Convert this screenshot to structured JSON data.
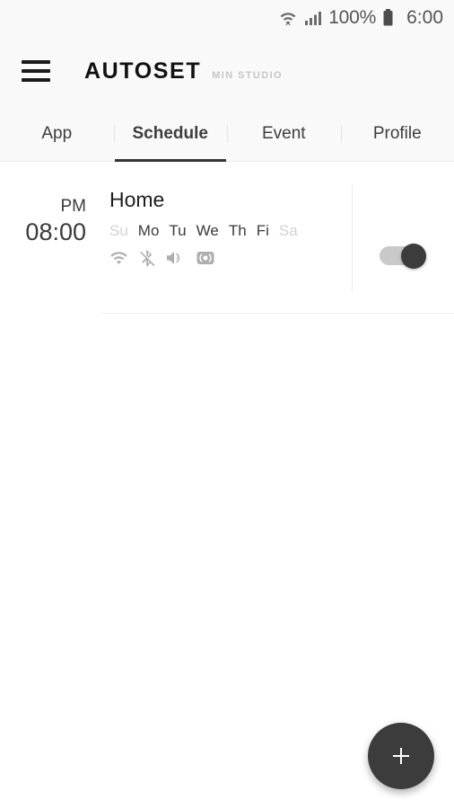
{
  "status_bar": {
    "battery_percent": "100%",
    "clock": "6:00",
    "icons": [
      "wifi-data-icon",
      "cellular-signal-icon",
      "battery-icon"
    ]
  },
  "app_bar": {
    "menu_icon": "hamburger-menu-icon",
    "brand": "AUTOSET",
    "brand_sub": "MIN STUDIO"
  },
  "tabs": [
    {
      "label": "App",
      "active": false
    },
    {
      "label": "Schedule",
      "active": true
    },
    {
      "label": "Event",
      "active": false
    },
    {
      "label": "Profile",
      "active": false
    }
  ],
  "schedules": [
    {
      "meridiem": "PM",
      "time": "08:00",
      "title": "Home",
      "days": [
        {
          "label": "Su",
          "active": false
        },
        {
          "label": "Mo",
          "active": true
        },
        {
          "label": "Tu",
          "active": true
        },
        {
          "label": "We",
          "active": true
        },
        {
          "label": "Th",
          "active": true
        },
        {
          "label": "Fi",
          "active": true
        },
        {
          "label": "Sa",
          "active": false
        }
      ],
      "flags": [
        "wifi-icon",
        "bluetooth-off-icon",
        "volume-icon",
        "hotspot-icon"
      ],
      "enabled": true
    }
  ],
  "fab": {
    "icon": "plus-icon",
    "label": "+"
  },
  "colors": {
    "accent": "#3c3c3c",
    "header_bg": "#f9f9f9",
    "content_bg": "#ffffff",
    "muted_text": "#d2d2d2",
    "icon_gray": "#a8a8a8"
  }
}
